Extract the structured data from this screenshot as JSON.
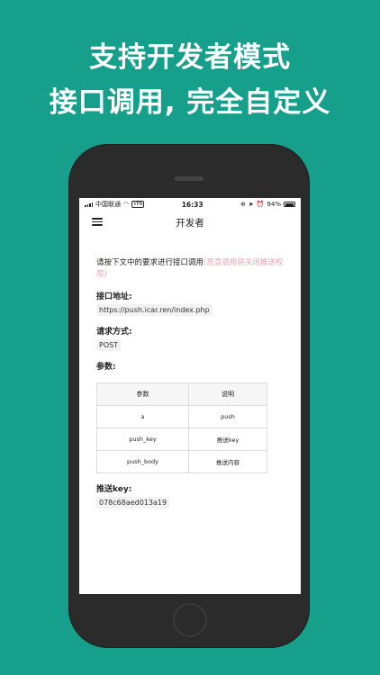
{
  "headline": {
    "line1": "支持开发者模式",
    "line2": "接口调用, 完全自定义"
  },
  "status_bar": {
    "carrier": "中国联通",
    "vpn": "VPN",
    "time": "16:33",
    "battery": "94%"
  },
  "nav": {
    "title": "开发者"
  },
  "content": {
    "intro": "请按下文中的要求进行接口调用",
    "intro_warning": "(恶意调用将关闭推送权限)",
    "endpoint_label": "接口地址:",
    "endpoint_value": "https://push.icar.ren/index.php",
    "method_label": "请求方式:",
    "method_value": "POST",
    "params_label": "参数:",
    "table": {
      "headers": [
        "参数",
        "说明"
      ],
      "rows": [
        [
          "a",
          "push"
        ],
        [
          "push_key",
          "推送key"
        ],
        [
          "push_body",
          "推送内容"
        ]
      ]
    },
    "push_key_label": "推送key:",
    "push_key_value": "078c68aed013a19"
  },
  "colors": {
    "background": "#16a08c",
    "warning_text": "#e6a6ad"
  }
}
